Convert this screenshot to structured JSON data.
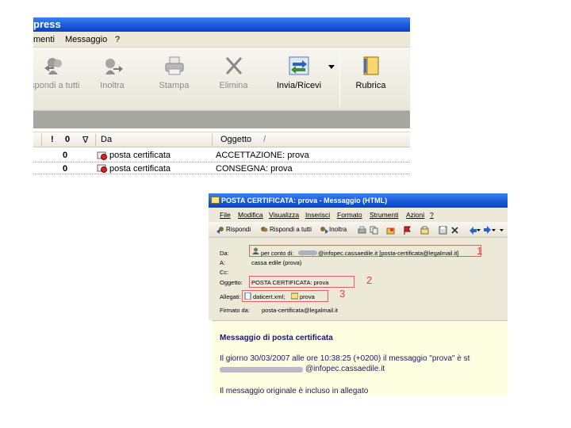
{
  "oe_window": {
    "title": "press",
    "menu": [
      "menti",
      "Messaggio",
      "?"
    ],
    "toolbar": [
      {
        "label": "spondi a tutti",
        "icon": "reply-all-icon"
      },
      {
        "label": "Inoltra",
        "icon": "forward-icon"
      },
      {
        "label": "Stampa",
        "icon": "print-icon"
      },
      {
        "label": "Elimina",
        "icon": "delete-icon"
      },
      {
        "label": "Invia/Ricevi",
        "icon": "send-receive-icon"
      },
      {
        "label": "Rubrica",
        "icon": "address-book-icon"
      }
    ],
    "columns": {
      "priority": "!",
      "attach": "0",
      "flag": "∇",
      "from": "Da",
      "subject": "Oggetto",
      "sort_mark": "/"
    },
    "rows": [
      {
        "from": "posta certificata",
        "subject": "ACCETTAZIONE: prova",
        "attach": "0"
      },
      {
        "from": "posta certificata",
        "subject": "CONSEGNA: prova",
        "attach": "0"
      }
    ]
  },
  "msg_window": {
    "title": "POSTA CERTIFICATA: prova - Messaggio (HTML)",
    "menu": [
      "File",
      "Modifica",
      "Visualizza",
      "Inserisci",
      "Formato",
      "Strumenti",
      "Azioni",
      "?"
    ],
    "toolbar": {
      "reply": "Rispondi",
      "reply_all": "Rispondi a tutti",
      "forward": "Inoltra"
    },
    "header": {
      "from_label": "Da:",
      "from_value": "per conto di:",
      "from_value_2": "@infopec.cassaedile.it [posta-certificata@legalmail.it]",
      "to_label": "A:",
      "to_value": "cassa edile (prova)",
      "cc_label": "Cc:",
      "subject_label": "Oggetto:",
      "subject_value": "POSTA CERTIFICATA: prova",
      "attach_label": "Allegati:",
      "attach_1": "daticert.xml;",
      "attach_2": "prova",
      "signed_label": "Firmato da:",
      "signed_value": "posta-certificata@legalmail.it"
    },
    "markers": [
      "1",
      "2",
      "3"
    ],
    "body": {
      "heading": "Messaggio di posta certificata",
      "line1": "Il giorno 30/03/2007 alle ore 10:38:25 (+0200) il messaggio \"prova\" è st",
      "line2": "@infopec.cassaedile.it",
      "line3": "Il messaggio originale è incluso in allegato"
    }
  }
}
